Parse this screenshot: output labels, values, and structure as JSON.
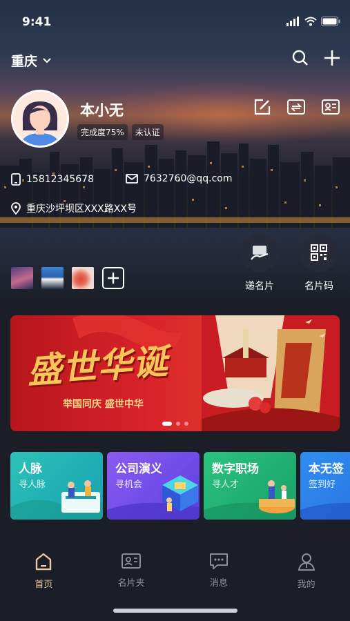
{
  "status_bar": {
    "time": "9:41"
  },
  "header": {
    "city": "重庆"
  },
  "profile": {
    "name": "本小无",
    "completion_badge": "完成度75%",
    "auth_badge": "未认证",
    "phone": "15812345678",
    "email": "7632760@qq.com",
    "address": "重庆沙坪坝区XXX路XX号"
  },
  "quick_actions": [
    {
      "label": "递名片",
      "icon": "card-share-icon"
    },
    {
      "label": "名片码",
      "icon": "qr-code-icon"
    }
  ],
  "banner": {
    "title": "盛世华诞",
    "subtitle": "举国同庆 盛世中华",
    "slide_count": 3,
    "active_slide": 1
  },
  "services": [
    {
      "title": "人脉",
      "subtitle": "寻人脉"
    },
    {
      "title": "公司演义",
      "subtitle": "寻机会"
    },
    {
      "title": "数字职场",
      "subtitle": "寻人才"
    },
    {
      "title": "本无签",
      "subtitle": "签到好"
    }
  ],
  "tabbar": [
    {
      "label": "首页",
      "icon": "home-icon",
      "active": true
    },
    {
      "label": "名片夹",
      "icon": "card-holder-icon",
      "active": false
    },
    {
      "label": "消息",
      "icon": "message-icon",
      "active": false
    },
    {
      "label": "我的",
      "icon": "profile-icon",
      "active": false
    }
  ],
  "colors": {
    "tab_active": "#e9c8a6",
    "tab_inactive": "#8c8f98",
    "banner_red": "#d8222a",
    "banner_gold": "#f7c55a"
  }
}
